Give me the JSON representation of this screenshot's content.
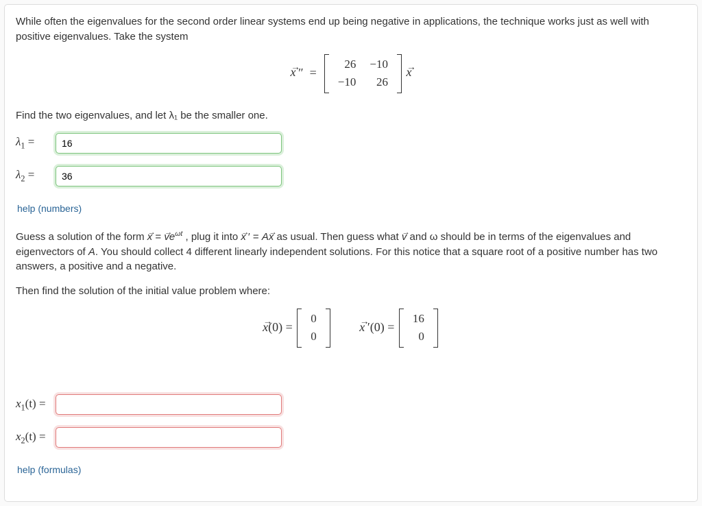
{
  "intro": "While often the eigenvalues for the second order linear systems end up being negative in applications, the technique works just as well with positive eigenvalues. Take the system",
  "matrix": {
    "a11": "26",
    "a12": "−10",
    "a21": "−10",
    "a22": "26"
  },
  "find_eigs": "Find the two eigenvalues, and let λ₁ be the smaller one.",
  "lambda1": {
    "label": "λ",
    "sub": "1",
    "eq": " = ",
    "value": "16"
  },
  "lambda2": {
    "label": "λ",
    "sub": "2",
    "eq": " = ",
    "value": "36"
  },
  "help_numbers": "help (numbers)",
  "guess_text_a": "Guess a solution of the form ",
  "guess_text_b": ", plug it into ",
  "guess_text_c": " as usual. Then guess what ",
  "guess_text_d": " and ω should be in terms of the eigenvalues and eigenvectors of ",
  "guess_text_e": ". You should collect 4 different linearly independent solutions. For this notice that a square root of a positive number has two answers, a positive and a negative.",
  "then_find": "Then find the solution of the initial value problem where:",
  "ivp": {
    "x0": {
      "top": "0",
      "bot": "0"
    },
    "xp0": {
      "top": "16",
      "bot": "0"
    }
  },
  "x1": {
    "label": "x",
    "sub": "1",
    "arg": "(t) = ",
    "value": ""
  },
  "x2": {
    "label": "x",
    "sub": "2",
    "arg": "(t) = ",
    "value": ""
  },
  "help_formulas": "help (formulas)"
}
